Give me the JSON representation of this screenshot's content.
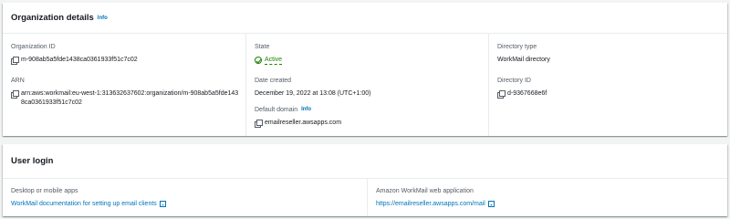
{
  "org_details": {
    "title": "Organization details",
    "info": "Info",
    "org_id_label": "Organization ID",
    "org_id_value": "m-908ab5a5fde1438ca0361933f51c7c02",
    "arn_label": "ARN",
    "arn_value": "arn:aws:workmail:eu-west-1:313632637602:organization/m-908ab5a5fde1438ca0361933f51c7c02",
    "state_label": "State",
    "state_value": "Active",
    "date_label": "Date created",
    "date_value": "December 19, 2022 at 13:08 (UTC+1:00)",
    "domain_label": "Default domain",
    "domain_info": "Info",
    "domain_value": "emailreseller.awsapps.com",
    "dir_type_label": "Directory type",
    "dir_type_value": "WorkMail directory",
    "dir_id_label": "Directory ID",
    "dir_id_value": "d-9367668e6f"
  },
  "user_login": {
    "title": "User login",
    "desktop_label": "Desktop or mobile apps",
    "desktop_link": "WorkMail documentation for setting up email clients",
    "web_label": "Amazon WorkMail web application",
    "web_link": "https://emailreseller.awsapps.com/mail"
  },
  "colors": {
    "link": "#0073bb",
    "success": "#1d8102",
    "background": "#f2f3f3"
  }
}
